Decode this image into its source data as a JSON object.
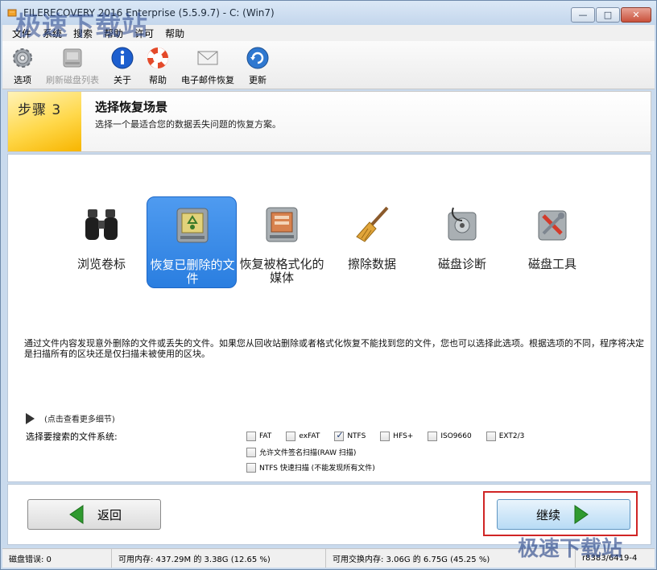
{
  "window": {
    "title": "FILERECOVERY 2016 Enterprise (5.5.9.7) - C: (Win7)",
    "controls": [
      "—",
      "□",
      "✕"
    ]
  },
  "menu": [
    "文件",
    "系统",
    "搜索",
    "帮助",
    "许可",
    "帮助"
  ],
  "toolbar": [
    {
      "label": "选项",
      "icon": "gear-icon",
      "enabled": true
    },
    {
      "label": "刷新磁盘列表",
      "icon": "disk-refresh-icon",
      "enabled": false
    },
    {
      "label": "关于",
      "icon": "info-icon",
      "enabled": true
    },
    {
      "label": "帮助",
      "icon": "lifebuoy-icon",
      "enabled": true
    },
    {
      "label": "电子邮件恢复",
      "icon": "envelope-icon",
      "enabled": true
    },
    {
      "label": "更新",
      "icon": "update-icon",
      "enabled": true
    }
  ],
  "step": {
    "badge": "步骤 3",
    "title": "选择恢复场景",
    "description": "选择一个最适合您的数据丢失问题的恢复方案。"
  },
  "scenarios": [
    {
      "label": "浏览卷标",
      "icon": "binoculars-icon",
      "selected": false
    },
    {
      "label": "恢复已删除的文件",
      "icon": "recycle-drive-icon",
      "selected": true
    },
    {
      "label": "恢复被格式化的媒体",
      "icon": "format-drive-icon",
      "selected": false
    },
    {
      "label": "擦除数据",
      "icon": "broom-icon",
      "selected": false
    },
    {
      "label": "磁盘诊断",
      "icon": "stethoscope-drive-icon",
      "selected": false
    },
    {
      "label": "磁盘工具",
      "icon": "tools-drive-icon",
      "selected": false
    }
  ],
  "info_text": "通过文件内容发现意外删除的文件或丢失的文件。如果您从回收站删除或者格式化恢复不能找到您的文件，您也可以选择此选项。根据选项的不同，程序将决定是扫描所有的区块还是仅扫描未被使用的区块。",
  "more_details": "(点击查看更多细节)",
  "filesystem_label": "选择要搜索的文件系统:",
  "filesystems": [
    {
      "name": "FAT",
      "checked": false
    },
    {
      "name": "exFAT",
      "checked": false
    },
    {
      "name": "NTFS",
      "checked": true
    },
    {
      "name": "HFS+",
      "checked": false
    },
    {
      "name": "ISO9660",
      "checked": false
    },
    {
      "name": "EXT2/3",
      "checked": false
    }
  ],
  "options": [
    {
      "label": "允许文件签名扫描(RAW 扫描)",
      "checked": false
    },
    {
      "label": "NTFS 快速扫描 (不能发现所有文件)",
      "checked": false
    }
  ],
  "buttons": {
    "back": "返回",
    "next": "继续"
  },
  "status": {
    "disk_errors": "磁盘错误: 0",
    "memory": "可用内存: 437.29M 的 3.38G (12.65 %)",
    "swap": "可用交换内存: 3.06G 的 6.75G (45.25 %)",
    "build": "r8383/6419-4"
  },
  "watermark": "极速下载站",
  "colors": {
    "accent": "#2a7ee0",
    "step_badge": "#ffd84a",
    "highlight_frame": "#d02525",
    "arrow_green": "#2f9a2f"
  }
}
